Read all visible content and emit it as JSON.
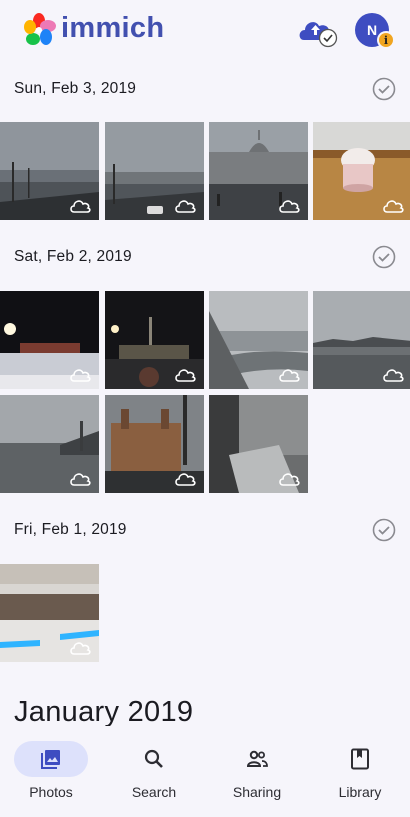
{
  "header": {
    "brand": "immich",
    "avatar_initial": "N",
    "avatar_badge": "i",
    "brand_color": "#4250af"
  },
  "groups": [
    {
      "title": "Sun, Feb 3, 2019"
    },
    {
      "title": "Sat, Feb 2, 2019"
    },
    {
      "title": "Fri, Feb 1, 2019"
    }
  ],
  "month_title": "January 2019",
  "nav": [
    {
      "label": "Photos",
      "icon": "photos-icon",
      "active": true
    },
    {
      "label": "Search",
      "icon": "search-icon",
      "active": false
    },
    {
      "label": "Sharing",
      "icon": "sharing-icon",
      "active": false
    },
    {
      "label": "Library",
      "icon": "library-icon",
      "active": false
    }
  ],
  "colors": {
    "background": "#f6f5fb",
    "accent": "#4250af",
    "active_pill": "#dde1fb",
    "badge": "#f0a520"
  }
}
